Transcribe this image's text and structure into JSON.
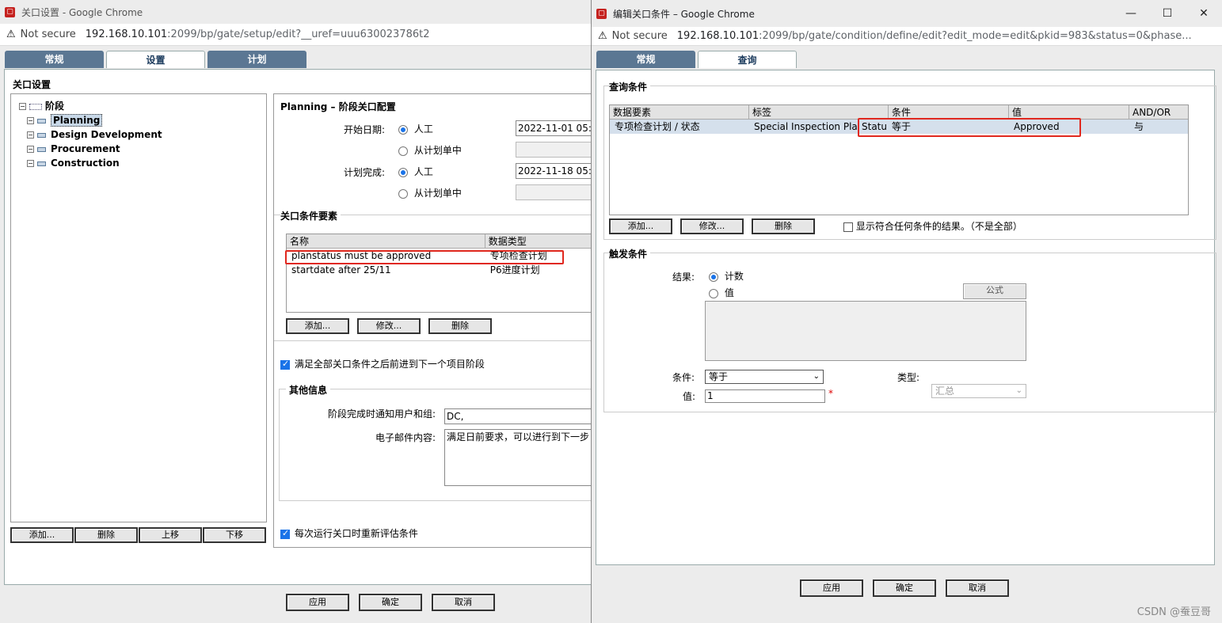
{
  "win1": {
    "title": "关口设置 - Google Chrome",
    "not_secure": "Not secure",
    "url_host": "192.168.10.101",
    "url_rest": ":2099/bp/gate/setup/edit?__uref=uuu630023786t2",
    "tabs": [
      "常规",
      "设置",
      "计划"
    ],
    "section_title": "关口设置",
    "tree": {
      "root": "阶段",
      "items": [
        "Planning",
        "Design Development",
        "Procurement",
        "Construction"
      ]
    },
    "tree_buttons": [
      "添加...",
      "删除",
      "上移",
      "下移"
    ],
    "config_title": "Planning – 阶段关口配置",
    "start_date_label": "开始日期:",
    "plan_finish_label": "计划完成:",
    "radio_manual": "人工",
    "radio_from_plan": "从计划单中",
    "start_date_value": "2022-11-01 05:",
    "finish_date_value": "2022-11-18 05:",
    "conditions": {
      "title": "关口条件要素",
      "col_name": "名称",
      "col_type": "数据类型",
      "rows": [
        {
          "name": "planstatus must be approved",
          "type": "专项检查计划"
        },
        {
          "name": "startdate after 25/11",
          "type": "P6进度计划"
        }
      ],
      "buttons": [
        "添加...",
        "修改...",
        "删除"
      ]
    },
    "check_all": "满足全部关口条件之后前进到下一个项目阶段",
    "other": {
      "title": "其他信息",
      "notify_label": "阶段完成时通知用户和组:",
      "notify_value": "DC,",
      "email_label": "电子邮件内容:",
      "email_value": "满足日前要求，可以进行到下一步"
    },
    "check_reeval": "每次运行关口时重新评估条件",
    "footer": [
      "应用",
      "确定",
      "取消"
    ]
  },
  "win2": {
    "title": "编辑关口条件 – Google Chrome",
    "not_secure": "Not secure",
    "url_host": "192.168.10.101",
    "url_rest": ":2099/bp/gate/condition/define/edit?edit_mode=edit&pkid=983&status=0&phase...",
    "tabs": [
      "常规",
      "查询"
    ],
    "query": {
      "title": "查询条件",
      "cols": [
        "数据要素",
        "标签",
        "条件",
        "值",
        "AND/OR"
      ],
      "row": {
        "element": "专项检查计划 / 状态",
        "label": "Special Inspection Plan",
        "label_tail": "Statu",
        "cond": "等于",
        "value": "Approved",
        "andor": "与"
      },
      "buttons": [
        "添加...",
        "修改...",
        "删除"
      ],
      "show_any": "显示符合任何条件的结果。（不是全部）"
    },
    "trigger": {
      "title": "触发条件",
      "result_label": "结果:",
      "count": "计数",
      "value_opt": "值",
      "formula_btn": "公式",
      "cond_label": "条件:",
      "cond_value": "等于",
      "type_label": "类型:",
      "type_value": "汇总",
      "val_label": "值:",
      "val_value": "1",
      "required": "*"
    },
    "footer": [
      "应用",
      "确定",
      "取消"
    ]
  },
  "watermark": "CSDN @蚕豆哥"
}
